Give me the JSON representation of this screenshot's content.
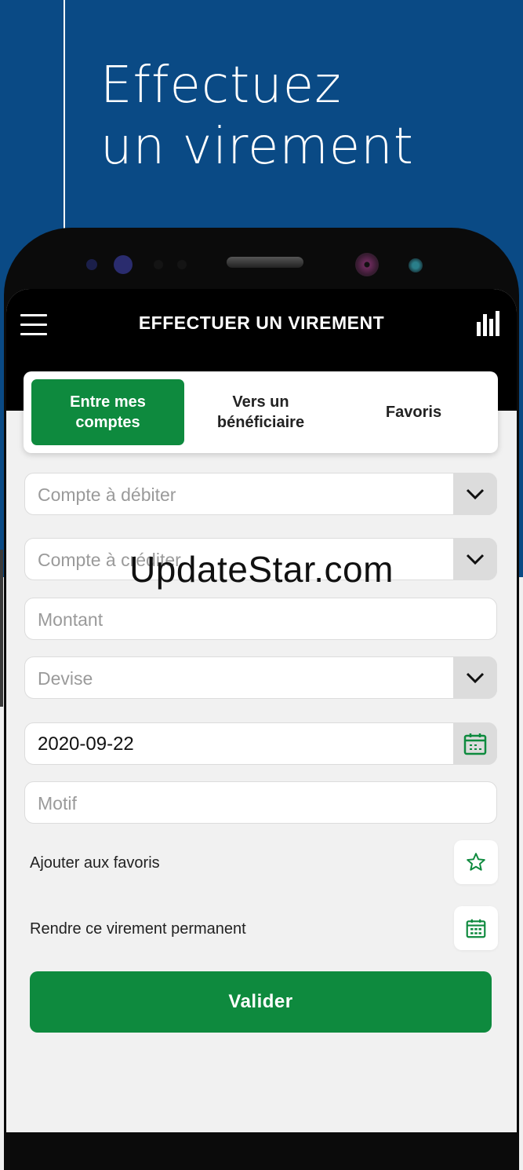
{
  "promo": {
    "line1": "Effectuez",
    "line2": "un virement"
  },
  "appbar": {
    "title": "EFFECTUER UN VIREMENT"
  },
  "tabs": [
    {
      "label_line1": "Entre mes",
      "label_line2": "comptes",
      "active": true
    },
    {
      "label_line1": "Vers un",
      "label_line2": "bénéficiaire",
      "active": false
    },
    {
      "label_line1": "Favoris",
      "label_line2": "",
      "active": false
    }
  ],
  "form": {
    "debit_placeholder": "Compte à débiter",
    "credit_placeholder": "Compte à créditer",
    "amount_placeholder": "Montant",
    "currency_placeholder": "Devise",
    "date_value": "2020-09-22",
    "reason_placeholder": "Motif"
  },
  "options": {
    "favorite_label": "Ajouter aux favoris",
    "permanent_label": "Rendre ce virement permanent"
  },
  "submit_label": "Valider",
  "watermark": "UpdateStar.com",
  "colors": {
    "brand_blue": "#0a4a85",
    "accent_green": "#0e8a3e",
    "appbar": "#000000"
  }
}
